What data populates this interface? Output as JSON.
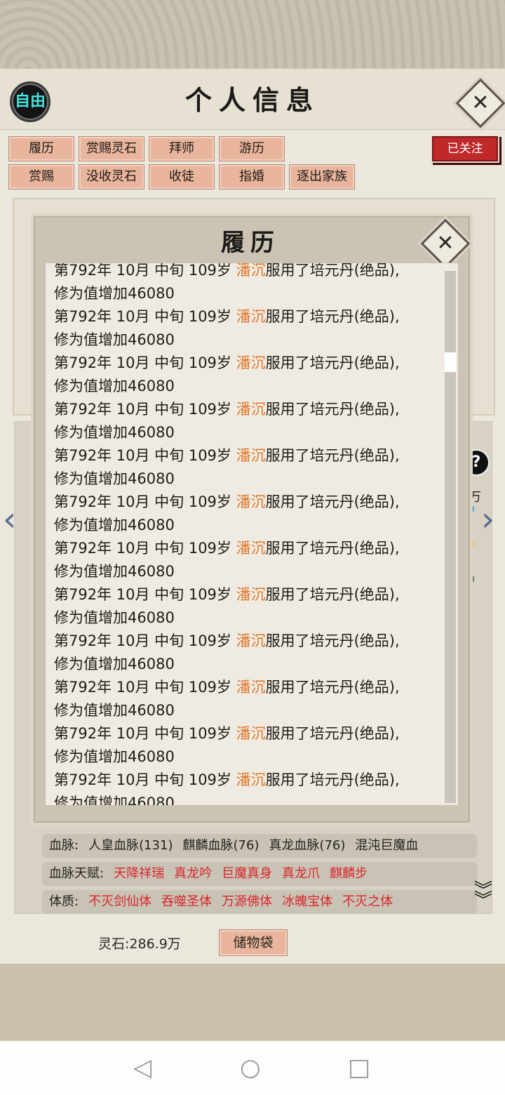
{
  "header": {
    "badge": "自由",
    "title": "个人信息"
  },
  "tabs": {
    "row1": [
      "履历",
      "赏赐灵石",
      "拜师",
      "游历"
    ],
    "row2": [
      "赏赐",
      "没收灵石",
      "收徒",
      "指婚",
      "逐出家族"
    ],
    "follow": "已关注"
  },
  "side": {
    "help": "?",
    "wan": "万"
  },
  "modal": {
    "title": "履历",
    "entries": [
      {
        "prefix": "第792年 10月 中旬 109岁 ",
        "name": "潘沉",
        "action": "服用了培元丹(绝品),",
        "line2": "修为值增加46080"
      },
      {
        "prefix": "第792年 10月 中旬 109岁 ",
        "name": "潘沉",
        "action": "服用了培元丹(绝品),",
        "line2": "修为值增加46080"
      },
      {
        "prefix": "第792年 10月 中旬 109岁 ",
        "name": "潘沉",
        "action": "服用了培元丹(绝品),",
        "line2": "修为值增加46080"
      },
      {
        "prefix": "第792年 10月 中旬 109岁 ",
        "name": "潘沉",
        "action": "服用了培元丹(绝品),",
        "line2": "修为值增加46080"
      },
      {
        "prefix": "第792年 10月 中旬 109岁 ",
        "name": "潘沉",
        "action": "服用了培元丹(绝品),",
        "line2": "修为值增加46080"
      },
      {
        "prefix": "第792年 10月 中旬 109岁 ",
        "name": "潘沉",
        "action": "服用了培元丹(绝品),",
        "line2": "修为值增加46080"
      },
      {
        "prefix": "第792年 10月 中旬 109岁 ",
        "name": "潘沉",
        "action": "服用了培元丹(绝品),",
        "line2": "修为值增加46080"
      },
      {
        "prefix": "第792年 10月 中旬 109岁 ",
        "name": "潘沉",
        "action": "服用了培元丹(绝品),",
        "line2": "修为值增加46080"
      },
      {
        "prefix": "第792年 10月 中旬 109岁 ",
        "name": "潘沉",
        "action": "服用了培元丹(绝品),",
        "line2": "修为值增加46080"
      },
      {
        "prefix": "第792年 10月 中旬 109岁 ",
        "name": "潘沉",
        "action": "服用了培元丹(绝品),",
        "line2": "修为值增加46080"
      },
      {
        "prefix": "第792年 10月 中旬 109岁 ",
        "name": "潘沉",
        "action": "服用了培元丹(绝品),",
        "line2": "修为值增加46080"
      },
      {
        "prefix": "第792年 10月 中旬 109岁 ",
        "name": "潘沉",
        "action": "服用了培元丹(绝品),",
        "line2": "修为值增加46080"
      },
      {
        "prefix": "第792年 10月 中旬 109岁 ",
        "name": "潘沉",
        "action": "服用了培元丹(绝品),",
        "line2": "修为值增加46080"
      }
    ]
  },
  "stats": {
    "bloodline": {
      "label": "血脉:",
      "values": [
        "人皇血脉(131)",
        "麒麟血脉(76)",
        "真龙血脉(76)",
        "混沌巨魔血"
      ]
    },
    "bloodline_talent": {
      "label": "血脉天赋:",
      "values": [
        "天降祥瑞",
        "真龙吟",
        "巨魔真身",
        "真龙爪",
        "麒麟步"
      ]
    },
    "physique": {
      "label": "体质:",
      "values": [
        "不灭剑仙体",
        "吞噬圣体",
        "万源佛体",
        "冰魄宝体",
        "不灭之体"
      ]
    }
  },
  "footer": {
    "stone_label": "灵石:286.9万",
    "bag": "储物袋"
  },
  "colors": {
    "name": "#e0772a",
    "red": "#d8262a",
    "accent_btn": "#e9b59c"
  }
}
